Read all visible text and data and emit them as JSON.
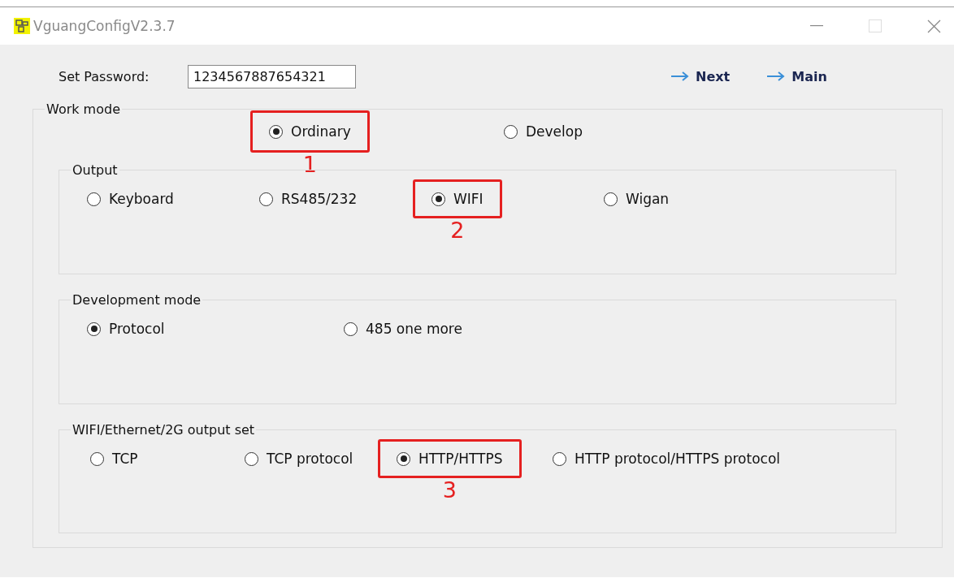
{
  "window": {
    "title": "VguangConfigV2.3.7"
  },
  "password": {
    "label": "Set Password:",
    "value": "1234567887654321"
  },
  "links": [
    {
      "label": "Next"
    },
    {
      "label": "Main"
    }
  ],
  "groups": [
    {
      "kind": "work",
      "title": "Work mode",
      "options": [
        {
          "label": "Ordinary",
          "selected": true,
          "highlighted": true,
          "marker": "1"
        },
        {
          "label": "Develop",
          "selected": false,
          "highlighted": false
        }
      ],
      "children": [
        {
          "kind": "output",
          "title": "Output",
          "options": [
            {
              "label": "Keyboard",
              "selected": false,
              "highlighted": false
            },
            {
              "label": "RS485/232",
              "selected": false,
              "highlighted": false
            },
            {
              "label": "WIFI",
              "selected": true,
              "highlighted": true,
              "marker": "2"
            },
            {
              "label": "Wigan",
              "selected": false,
              "highlighted": false
            }
          ]
        },
        {
          "kind": "dev",
          "title": "Development mode",
          "options": [
            {
              "label": "Protocol",
              "selected": true,
              "highlighted": false
            },
            {
              "label": "485 one more",
              "selected": false,
              "highlighted": false
            }
          ]
        },
        {
          "kind": "net",
          "title": "WIFI/Ethernet/2G output set",
          "options": [
            {
              "label": "TCP",
              "selected": false,
              "highlighted": false
            },
            {
              "label": "TCP protocol",
              "selected": false,
              "highlighted": false
            },
            {
              "label": "HTTP/HTTPS",
              "selected": true,
              "highlighted": true,
              "marker": "3"
            },
            {
              "label": "HTTP protocol/HTTPS protocol",
              "selected": false,
              "highlighted": false
            }
          ]
        }
      ]
    }
  ]
}
